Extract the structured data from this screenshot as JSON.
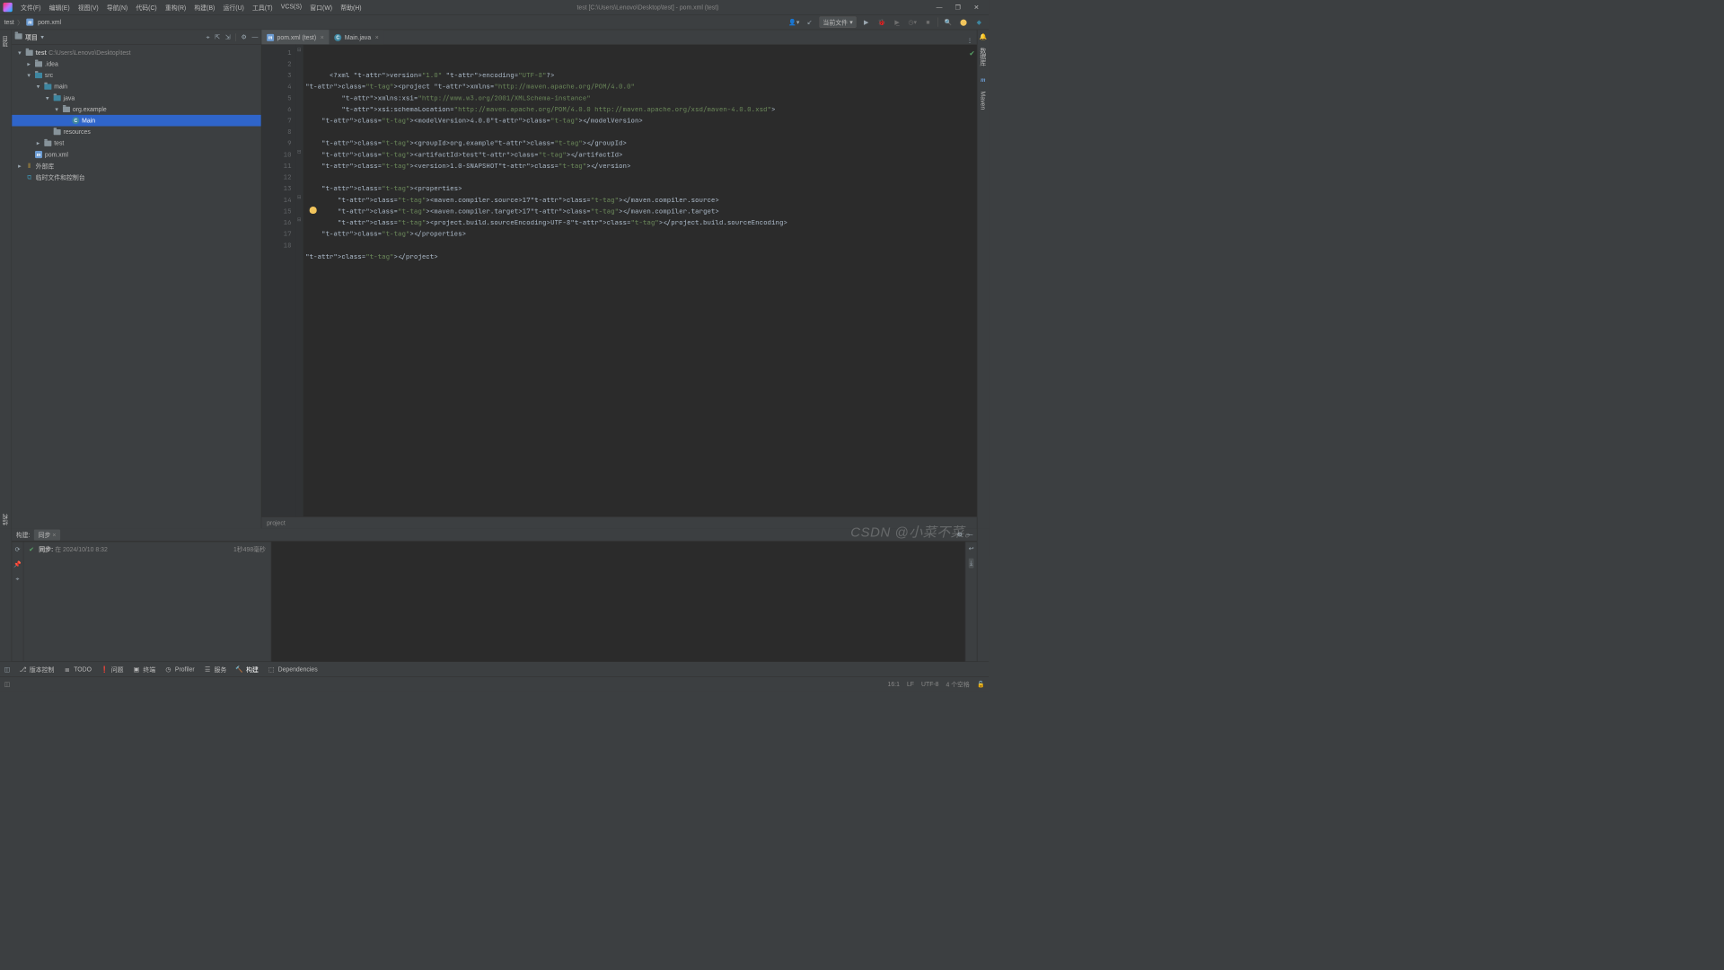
{
  "menu": {
    "items": [
      "文件(F)",
      "编辑(E)",
      "视图(V)",
      "导航(N)",
      "代码(C)",
      "重构(R)",
      "构建(B)",
      "运行(U)",
      "工具(T)",
      "VCS(S)",
      "窗口(W)",
      "帮助(H)"
    ]
  },
  "window_title": "test [C:\\Users\\Lenovo\\Desktop\\test] - pom.xml (test)",
  "breadcrumb": {
    "root": "test",
    "file": "pom.xml"
  },
  "run_config": "当前文件",
  "project_pane": {
    "title": "项目",
    "tree": [
      {
        "depth": 0,
        "arrow": "▾",
        "icon": "folder",
        "label": "test",
        "extra": "C:\\Users\\Lenovo\\Desktop\\test",
        "bold": true
      },
      {
        "depth": 1,
        "arrow": "▸",
        "icon": "folder",
        "label": ".idea"
      },
      {
        "depth": 1,
        "arrow": "▾",
        "icon": "folder-src",
        "label": "src"
      },
      {
        "depth": 2,
        "arrow": "▾",
        "icon": "folder-src",
        "label": "main"
      },
      {
        "depth": 3,
        "arrow": "▾",
        "icon": "folder-src",
        "label": "java"
      },
      {
        "depth": 4,
        "arrow": "▾",
        "icon": "folder-pkg",
        "label": "org.example"
      },
      {
        "depth": 5,
        "arrow": "",
        "icon": "java",
        "label": "Main",
        "selected": true
      },
      {
        "depth": 3,
        "arrow": "",
        "icon": "folder",
        "label": "resources"
      },
      {
        "depth": 2,
        "arrow": "▸",
        "icon": "folder",
        "label": "test"
      },
      {
        "depth": 1,
        "arrow": "",
        "icon": "pom",
        "label": "pom.xml"
      },
      {
        "depth": 0,
        "arrow": "▸",
        "icon": "libs",
        "label": "外部库"
      },
      {
        "depth": 0,
        "arrow": "",
        "icon": "console",
        "label": "临时文件和控制台"
      }
    ]
  },
  "tabs": [
    {
      "icon": "pom",
      "label": "pom.xml (test)",
      "active": true
    },
    {
      "icon": "java",
      "label": "Main.java",
      "active": false
    }
  ],
  "code_lines": [
    "<?xml version=\"1.0\" encoding=\"UTF-8\"?>",
    "<project xmlns=\"http://maven.apache.org/POM/4.0.0\"",
    "         xmlns:xsi=\"http://www.w3.org/2001/XMLSchema-instance\"",
    "         xsi:schemaLocation=\"http://maven.apache.org/POM/4.0.0 http://maven.apache.org/xsd/maven-4.0.0.xsd\">",
    "    <modelVersion>4.0.0</modelVersion>",
    "",
    "    <groupId>org.example</groupId>",
    "    <artifactId>test</artifactId>",
    "    <version>1.0-SNAPSHOT</version>",
    "",
    "    <properties>",
    "        <maven.compiler.source>17</maven.compiler.source>",
    "        <maven.compiler.target>17</maven.compiler.target>",
    "        <project.build.sourceEncoding>UTF-8</project.build.sourceEncoding>",
    "    </properties>",
    "",
    "</project>",
    ""
  ],
  "editor_breadcrumb": "project",
  "build": {
    "title": "构建:",
    "tab": "同步",
    "task": "同步:",
    "task_detail": "在 2024/10/10 8:32",
    "duration": "1秒498毫秒"
  },
  "toolstrip": [
    {
      "icon": "⎇",
      "label": "版本控制"
    },
    {
      "icon": "≣",
      "label": "TODO"
    },
    {
      "icon": "❗",
      "label": "问题"
    },
    {
      "icon": "▣",
      "label": "终端"
    },
    {
      "icon": "◷",
      "label": "Profiler"
    },
    {
      "icon": "☰",
      "label": "服务"
    },
    {
      "icon": "🔨",
      "label": "构建",
      "active": true
    },
    {
      "icon": "⬚",
      "label": "Dependencies"
    }
  ],
  "status": {
    "pos": "16:1",
    "lf": "LF",
    "enc": "UTF-8",
    "spaces": "4 个空格"
  },
  "right_tabs": [
    "通知",
    "数据库",
    "Maven"
  ],
  "left_tabs": [
    "项目",
    "结构"
  ],
  "watermark": "CSDN @小菜不菜。"
}
